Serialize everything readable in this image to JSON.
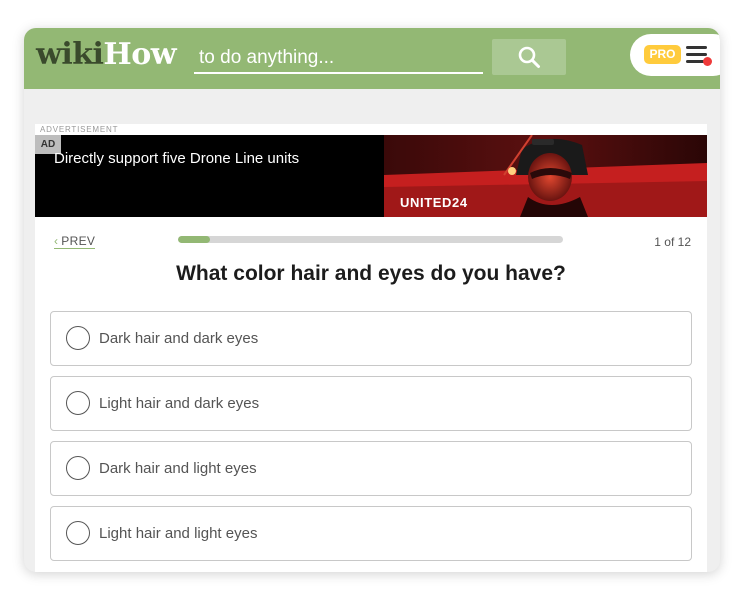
{
  "header": {
    "logo_part1": "wiki",
    "logo_part2": "How",
    "search_placeholder": "to do anything...",
    "search_icon": "search-icon",
    "pro_badge": "PRO",
    "menu_icon": "hamburger-icon",
    "brand_color": "#93b874",
    "pro_color": "#ffcb3c",
    "notification_color": "#ee3a3a"
  },
  "advertisement": {
    "label": "ADVERTISEMENT",
    "badge": "AD",
    "headline": "Directly support five Drone Line units",
    "brand": "UNITED24"
  },
  "quiz": {
    "prev_label": "PREV",
    "progress_fraction": 0.0833,
    "progress_text": "1 of 12",
    "question": "What color hair and eyes do you have?",
    "options": [
      {
        "label": "Dark hair and dark eyes"
      },
      {
        "label": "Light hair and dark eyes"
      },
      {
        "label": "Dark hair and light eyes"
      },
      {
        "label": "Light hair and light eyes"
      }
    ]
  }
}
